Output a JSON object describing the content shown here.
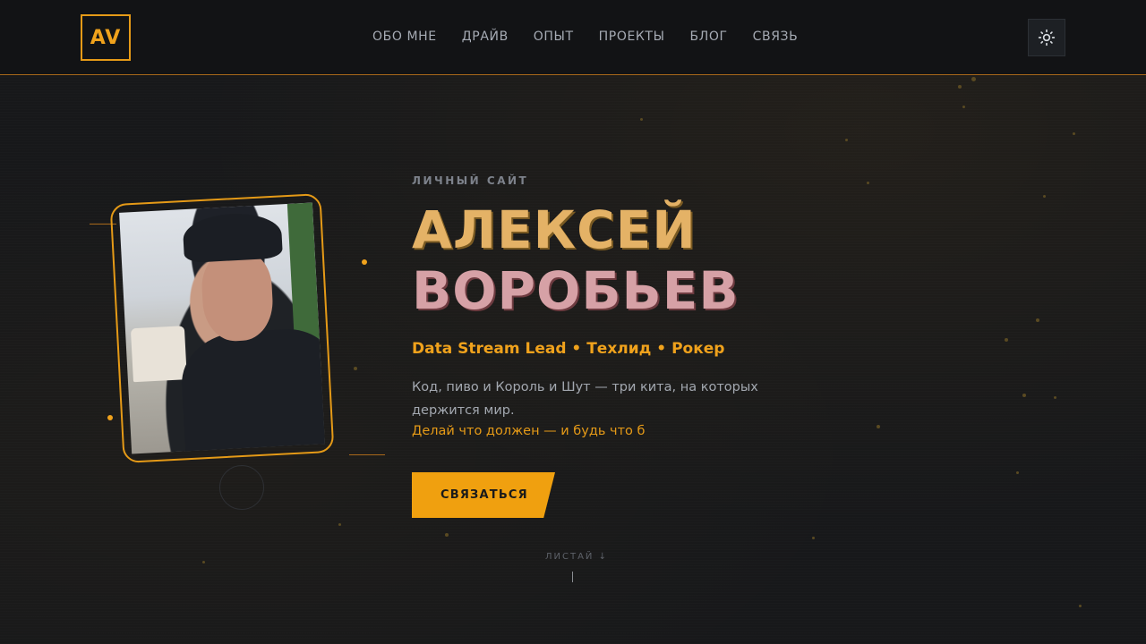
{
  "header": {
    "logo": "AV",
    "nav": [
      "ОБО МНЕ",
      "ДРАЙВ",
      "ОПЫТ",
      "ПРОЕКТЫ",
      "БЛОГ",
      "СВЯЗЬ"
    ],
    "theme_icon": "sun-icon"
  },
  "hero": {
    "eyebrow": "ЛИЧНЫЙ САЙТ",
    "first_name": "АЛЕКСЕЙ",
    "last_name": "ВОРОБЬЕВ",
    "role": "Data Stream Lead • Техлид • Рокер",
    "description": "Код, пиво и Король и Шут — три кита, на которых держится мир.",
    "motto": "Делай что должен — и будь что б",
    "cta": "СВЯЗАТЬСЯ",
    "scroll_hint": "ЛИСТАЙ ↓"
  },
  "colors": {
    "accent": "#f0a21c",
    "background": "#17181a",
    "header_bg": "#121315"
  }
}
